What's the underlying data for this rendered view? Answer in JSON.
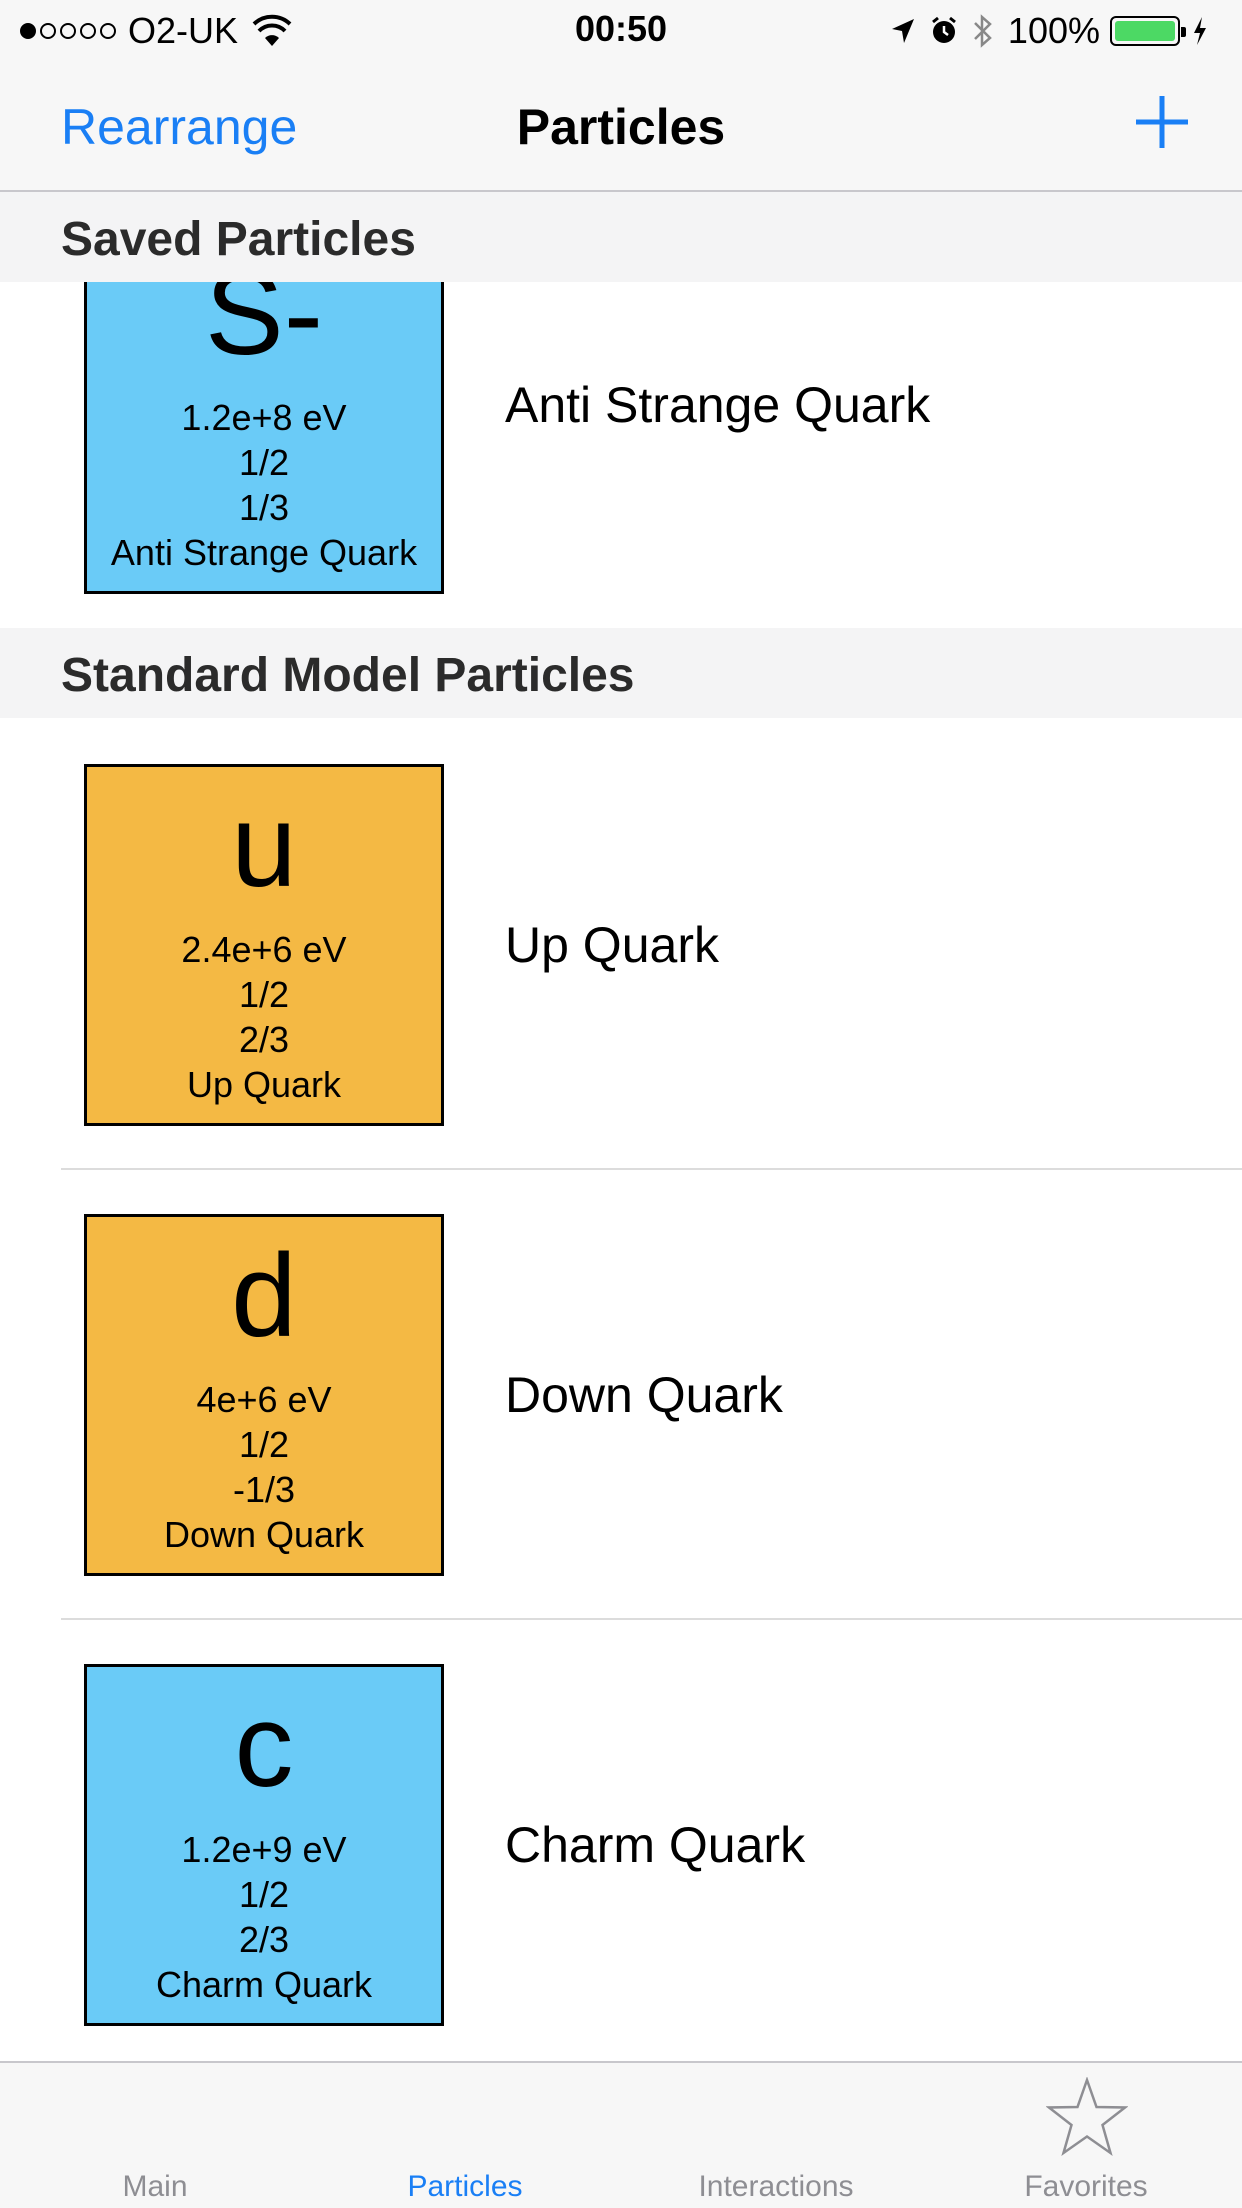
{
  "status_bar": {
    "carrier": "O2-UK",
    "time": "00:50",
    "battery_percent": "100%",
    "battery_level": 1.0,
    "icons": [
      "signal-dots-icon",
      "wifi-icon",
      "location-arrow-icon",
      "alarm-icon",
      "bluetooth-icon",
      "battery-icon",
      "charging-bolt-icon"
    ]
  },
  "nav": {
    "left_button": "Rearrange",
    "title": "Particles",
    "right_icon": "plus-icon"
  },
  "colors": {
    "accent": "#1a7ff5",
    "quark_blue": "#6acbf7",
    "quark_orange": "#f4b944"
  },
  "sections": [
    {
      "header": "Saved Particles",
      "items": [
        {
          "symbol": "S-",
          "mass": "1.2e+8 eV",
          "spin": "1/2",
          "charge": "1/3",
          "tile_label": "Anti Strange Quark",
          "name": "Anti Strange Quark",
          "color": "blue"
        }
      ]
    },
    {
      "header": "Standard Model Particles",
      "items": [
        {
          "symbol": "u",
          "mass": "2.4e+6 eV",
          "spin": "1/2",
          "charge": "2/3",
          "tile_label": "Up Quark",
          "name": "Up Quark",
          "color": "orange"
        },
        {
          "symbol": "d",
          "mass": "4e+6 eV",
          "spin": "1/2",
          "charge": "-1/3",
          "tile_label": "Down Quark",
          "name": "Down Quark",
          "color": "orange"
        },
        {
          "symbol": "c",
          "mass": "1.2e+9 eV",
          "spin": "1/2",
          "charge": "2/3",
          "tile_label": "Charm Quark",
          "name": "Charm Quark",
          "color": "blue"
        }
      ]
    }
  ],
  "tabs": [
    {
      "label": "Main",
      "icon": "main-tab-icon",
      "active": false
    },
    {
      "label": "Particles",
      "icon": "particles-tab-icon",
      "active": true
    },
    {
      "label": "Interactions",
      "icon": "interactions-tab-icon",
      "active": false
    },
    {
      "label": "Favorites",
      "icon": "star-icon",
      "active": false
    }
  ]
}
